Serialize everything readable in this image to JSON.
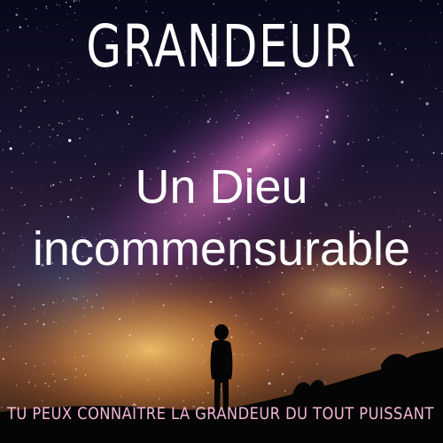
{
  "image": {
    "heading": "GRANDEUR",
    "subtitle_line1": "Un Dieu",
    "subtitle_line2": "incommensurable",
    "tagline": "TU PEUX CONNAÎTRE LA GRANDEUR DU TOUT PUISSANT",
    "colors": {
      "heading": "#ffffff",
      "tagline": "#f2b6d6",
      "sky_top": "#0b0b1e",
      "milky_way": "#c86aa8",
      "horizon_glow": "#f0a040",
      "silhouette": "#050505"
    }
  }
}
